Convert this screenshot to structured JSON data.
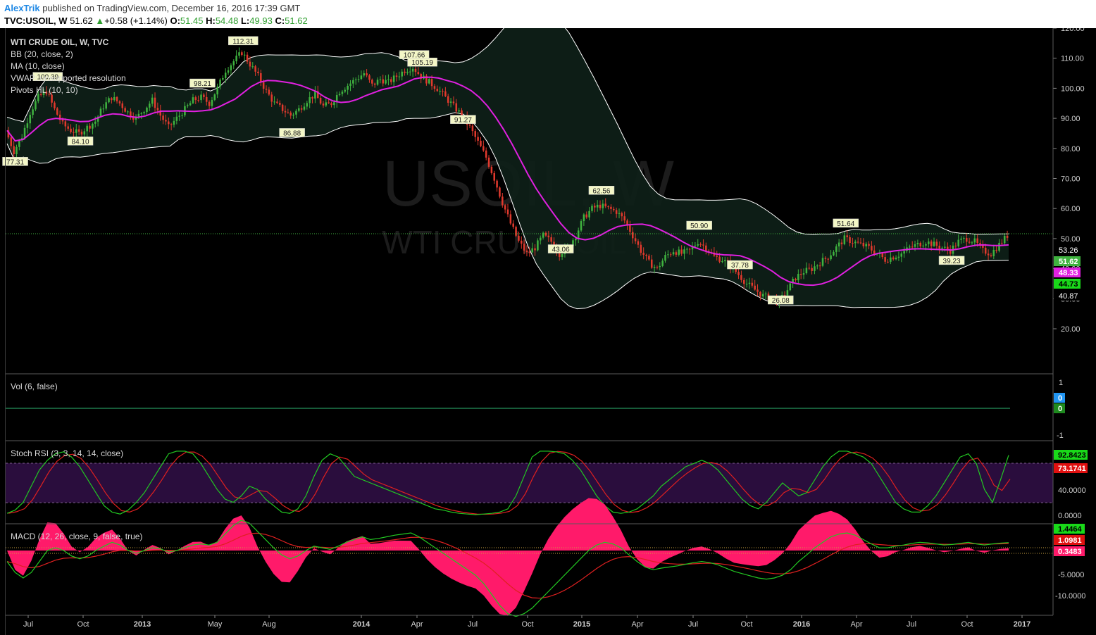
{
  "header": {
    "author": "AlexTrik",
    "published": "published on TradingView.com, December 16, 2016 17:39 GMT",
    "symbol": "TVC:USOIL, W",
    "last": "51.62",
    "change": "+0.58 (+1.14%)",
    "o_label": "O:",
    "open": "51.45",
    "h_label": "H:",
    "high": "54.48",
    "l_label": "L:",
    "low": "49.93",
    "c_label": "C:",
    "close": "51.62"
  },
  "colors": {
    "up": "#3fb23f",
    "down": "#e0392d",
    "ma": "#e020e0",
    "band": "#ffffff",
    "stoch_k": "#22c822",
    "stoch_d": "#e02020",
    "macd_hist": "#ff1a6a",
    "stoch_bg": "#2a0d3d"
  },
  "chart_data": [
    {
      "type": "candlestick",
      "title": "WTI CRUDE OIL, W, TVC",
      "indicators": [
        "BB (20, close, 2)",
        "MA (10, close)",
        "VWAP: unsupported resolution",
        "Pivots HL (10, 10)"
      ],
      "watermark": [
        "USOIL, W",
        "WTI CRUDE OIL"
      ],
      "x_ticks": [
        "Jul",
        "Oct",
        "2013",
        "May",
        "Aug",
        "2014",
        "Apr",
        "Jul",
        "Oct",
        "2015",
        "Apr",
        "Jul",
        "Oct",
        "2016",
        "Apr",
        "Jul",
        "Oct",
        "2017"
      ],
      "y_ticks": [
        "120.00",
        "110.00",
        "100.00",
        "90.00",
        "80.00",
        "70.00",
        "60.00",
        "50.00",
        "40.00",
        "30.00",
        "20.00"
      ],
      "ylim": [
        15,
        125
      ],
      "right_labels": [
        "53.26",
        "51.62",
        "48.33",
        "44.73",
        "40.87"
      ],
      "price_path": [
        86,
        79,
        84,
        92,
        97,
        99,
        93,
        88,
        86,
        85,
        87,
        89,
        94,
        97,
        95,
        92,
        90,
        93,
        96,
        91,
        87,
        90,
        93,
        96,
        97,
        95,
        100,
        106,
        109,
        112,
        108,
        104,
        99,
        95,
        93,
        91,
        93,
        96,
        98,
        94,
        95,
        99,
        101,
        103,
        105,
        101,
        103,
        102,
        104,
        106,
        107,
        104,
        102,
        100,
        97,
        94,
        91,
        87,
        82,
        77,
        70,
        62,
        55,
        49,
        45,
        47,
        51,
        49,
        45,
        47,
        51,
        57,
        60,
        61,
        60,
        59,
        56,
        51,
        46,
        42,
        40,
        44,
        46,
        45,
        46,
        49,
        47,
        44,
        43,
        41,
        38,
        35,
        33,
        31,
        30,
        29,
        33,
        37,
        39,
        40,
        42,
        44,
        47,
        50,
        49,
        48,
        47,
        45,
        43,
        44,
        45,
        47,
        48,
        49,
        48,
        47,
        46,
        49,
        50,
        49,
        46,
        45,
        48,
        51
      ],
      "pivot_labels": [
        "77.31",
        "100.39",
        "84.10",
        "98.21",
        "86.88",
        "112.31",
        "91.27",
        "105.19",
        "107.66",
        "43.06",
        "62.56",
        "37.78",
        "50.90",
        "26.08",
        "51.64",
        "39.23"
      ]
    },
    {
      "type": "area",
      "title": "Vol (6, false)",
      "y_ticks": [
        "1",
        "0",
        "-1"
      ],
      "right_labels": [
        "0",
        "0"
      ]
    },
    {
      "type": "line",
      "title": "Stoch RSI (3, 3, 14, 14, close)",
      "y_ticks": [
        "40.0000",
        "0.0000"
      ],
      "right_labels": [
        "92.8423",
        "73.1741"
      ],
      "series": [
        {
          "values": [
            3,
            8,
            20,
            45,
            70,
            85,
            95,
            98,
            90,
            75,
            55,
            35,
            15,
            5,
            2,
            8,
            20,
            35,
            55,
            75,
            95,
            99,
            99,
            95,
            80,
            60,
            40,
            25,
            20,
            30,
            45,
            40,
            25,
            15,
            5,
            3,
            10,
            30,
            60,
            85,
            95,
            90,
            75,
            60,
            55,
            50,
            45,
            40,
            35,
            30,
            25,
            20,
            15,
            10,
            8,
            5,
            3,
            2,
            1,
            2,
            3,
            5,
            10,
            30,
            60,
            90,
            99,
            99,
            98,
            95,
            85,
            70,
            50,
            30,
            15,
            5,
            3,
            5,
            10,
            20,
            30,
            45,
            55,
            65,
            75,
            80,
            85,
            80,
            70,
            55,
            40,
            25,
            15,
            10,
            20,
            35,
            50,
            40,
            30,
            35,
            55,
            75,
            90,
            99,
            99,
            95,
            90,
            80,
            60,
            40,
            20,
            10,
            5,
            5,
            15,
            30,
            50,
            70,
            90,
            95,
            80,
            40,
            20,
            55,
            92.84
          ]
        }
      ]
    },
    {
      "type": "line",
      "title": "MACD (12, 26, close, 9, false, true)",
      "y_ticks": [
        "-5.0000",
        "-10.0000"
      ],
      "right_labels": [
        "1.4464",
        "1.0981",
        "0.3483"
      ],
      "series": [
        {
          "values": [
            -2,
            -4,
            -5,
            -4,
            -2,
            0,
            0.5,
            0,
            -1,
            -1.5,
            -1,
            0,
            0.8,
            1.5,
            1,
            0,
            -0.5,
            0,
            0.5,
            0.3,
            -0.3,
            0,
            0.5,
            1,
            1.2,
            1,
            1.5,
            3,
            4.5,
            5.5,
            5,
            3.5,
            2,
            0.5,
            -0.8,
            -1.5,
            -1,
            0,
            0.8,
            0.5,
            0.2,
            0.8,
            1.5,
            2,
            2.5,
            2,
            2.2,
            2.5,
            2.8,
            3,
            3.2,
            2.5,
            1.5,
            0.5,
            -0.5,
            -1.5,
            -2.5,
            -3.5,
            -4.5,
            -6,
            -8,
            -10,
            -11.5,
            -12,
            -11.5,
            -10.5,
            -9,
            -7.5,
            -6,
            -4.5,
            -3,
            -1.5,
            0,
            1,
            1.5,
            1.2,
            0.5,
            -0.8,
            -2,
            -3,
            -3.5,
            -3.2,
            -3,
            -2.8,
            -2.5,
            -2.2,
            -2,
            -2.2,
            -2.6,
            -3.2,
            -3.8,
            -4.2,
            -4.6,
            -5,
            -5.2,
            -5,
            -4.5,
            -3.5,
            -2,
            -0.8,
            0.5,
            1.5,
            2.5,
            3,
            3.2,
            2.8,
            2,
            1.2,
            0.5,
            0.5,
            0.8,
            1,
            1.3,
            1.5,
            1.4,
            1.2,
            1,
            1.1,
            1.3,
            1.5,
            1.2,
            1,
            1.2,
            1.35,
            1.45
          ]
        }
      ]
    }
  ]
}
